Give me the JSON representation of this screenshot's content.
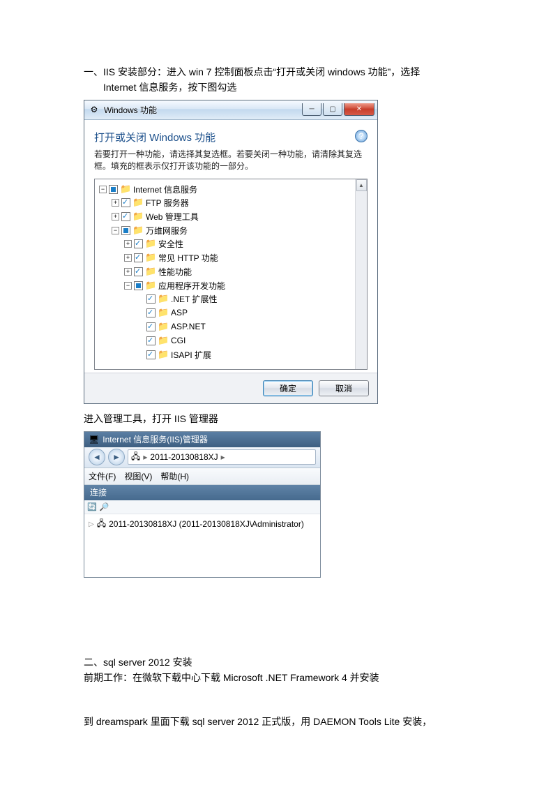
{
  "doc": {
    "section1_line1": "一、IIS 安装部分：进入 win 7 控制面板点击“打开或关闭 windows 功能”，选择",
    "section1_line2": "Internet 信息服务，按下图勾选",
    "after_dialog": "进入管理工具，打开 IIS 管理器",
    "section2_line1": "二、sql server 2012 安装",
    "section2_line2": "前期工作：在微软下载中心下载 Microsoft .NET Framework 4 并安装",
    "section2_line3": "到 dreamspark 里面下载 sql server 2012 正式版，用 DAEMON Tools Lite 安装，"
  },
  "dialog": {
    "title": "Windows 功能",
    "heading": "打开或关闭 Windows 功能",
    "desc": "若要打开一种功能，请选择其复选框。若要关闭一种功能，请清除其复选框。填充的框表示仅打开该功能的一部分。",
    "ok": "确定",
    "cancel": "取消",
    "tree": {
      "root": "Internet 信息服务",
      "ftp": "FTP 服务器",
      "webmgmt": "Web 管理工具",
      "www": "万维网服务",
      "security": "安全性",
      "http": "常见 HTTP 功能",
      "perf": "性能功能",
      "appdev": "应用程序开发功能",
      "netext": ".NET 扩展性",
      "asp": "ASP",
      "aspnet": "ASP.NET",
      "cgi": "CGI",
      "isapi": "ISAPI 扩展"
    }
  },
  "iis": {
    "title": "Internet 信息服务(IIS)管理器",
    "breadcrumb_server": "2011-20130818XJ",
    "menu_file": "文件(F)",
    "menu_view": "视图(V)",
    "menu_help": "帮助(H)",
    "panel_header": "连接",
    "node": "2011-20130818XJ (2011-20130818XJ\\Administrator)"
  }
}
